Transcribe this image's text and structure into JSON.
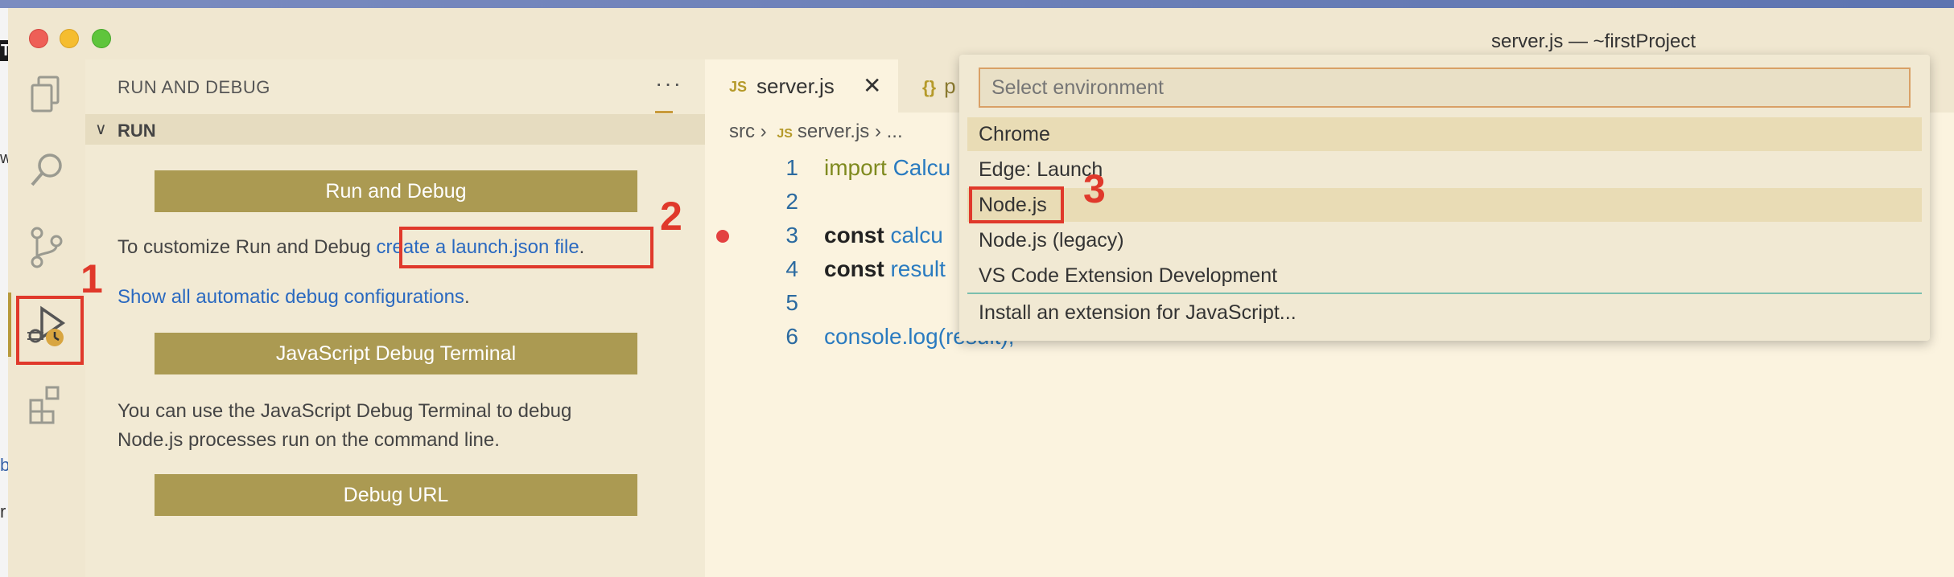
{
  "window": {
    "title": "server.js — ~firstProject"
  },
  "background_window": {
    "fragments": [
      "Tr",
      "w",
      "b",
      "r"
    ]
  },
  "activity_bar": {
    "items": [
      {
        "name": "explorer-icon"
      },
      {
        "name": "search-icon"
      },
      {
        "name": "source-control-icon"
      },
      {
        "name": "run-and-debug-icon",
        "active": true
      },
      {
        "name": "extensions-icon"
      }
    ]
  },
  "sidebar": {
    "title": "RUN AND DEBUG",
    "more": "···",
    "section": "RUN",
    "run_debug_button": "Run and Debug",
    "customize_text": "To customize Run and Debug ",
    "customize_link": "create a launch.json file",
    "customize_end": ".",
    "show_configs_link": "Show all automatic debug configurations",
    "show_configs_end": ".",
    "js_terminal_button": "JavaScript Debug Terminal",
    "terminal_desc_1": "You can use the JavaScript Debug Terminal to debug",
    "terminal_desc_2": "Node.js processes run on the command line.",
    "debug_url_button": "Debug URL"
  },
  "editor": {
    "tabs": [
      {
        "badge": "JS",
        "label": "server.js",
        "close": "✕"
      },
      {
        "badge": "{}",
        "label": "p"
      }
    ],
    "breadcrumb": {
      "folder": "src",
      "badge": "JS",
      "file": "server.js",
      "more": "..."
    },
    "lines": [
      {
        "n": "1",
        "a": "import",
        "b": " Calcu",
        "c": ""
      },
      {
        "n": "2",
        "a": "",
        "b": "",
        "c": ""
      },
      {
        "n": "3",
        "a": "const",
        "b": " calcu",
        "c": ""
      },
      {
        "n": "4",
        "a": "const",
        "b": " result",
        "c": ""
      },
      {
        "n": "5",
        "a": "",
        "b": "",
        "c": ""
      },
      {
        "n": "6",
        "a": "console",
        "b": ".log(",
        "c": "result);"
      }
    ]
  },
  "quick_pick": {
    "placeholder": "Select environment",
    "items": [
      "Chrome",
      "Edge: Launch",
      "Node.js",
      "Node.js (legacy)",
      "VS Code Extension Development"
    ],
    "footer_item": "Install an extension for JavaScript..."
  },
  "annotations": [
    "1",
    "2",
    "3"
  ],
  "colors": {
    "annotation": "#e0392b",
    "button": "#ab9a52",
    "link": "#2a69c0",
    "breakpoint": "#e34040"
  }
}
